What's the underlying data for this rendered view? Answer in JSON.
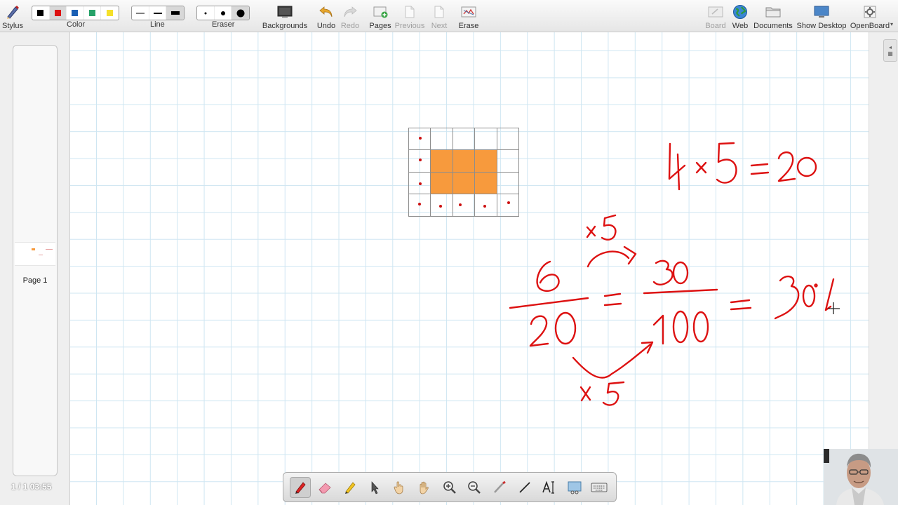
{
  "toolbar": {
    "stylus": "Stylus",
    "color": "Color",
    "line": "Line",
    "eraser": "Eraser",
    "backgrounds": "Backgrounds",
    "undo": "Undo",
    "redo": "Redo",
    "pages": "Pages",
    "previous": "Previous",
    "next": "Next",
    "erase": "Erase",
    "board": "Board",
    "web": "Web",
    "documents": "Documents",
    "show_desktop": "Show Desktop",
    "openboard": "OpenBoard"
  },
  "colors": [
    "#000000",
    "#dd1111",
    "#1a5fb4",
    "#26a269",
    "#f5e02a"
  ],
  "selected_color": "#dd1111",
  "left_panel": {
    "page_label": "Page 1",
    "page_info": "1 / 1  03:55"
  },
  "board": {
    "grid_cells_filled": [
      [
        1,
        1
      ],
      [
        1,
        2
      ],
      [
        1,
        3
      ],
      [
        2,
        1
      ],
      [
        2,
        2
      ],
      [
        2,
        3
      ]
    ],
    "grid_rows": 4,
    "grid_cols": 5,
    "handwriting": [
      "4 × 5 = 20",
      "×5",
      "6/20 = 30/100 = 30%",
      "×5"
    ]
  },
  "dock": {
    "tools": [
      "pen-tool-icon",
      "eraser-tool-icon",
      "highlighter-tool-icon",
      "select-tool-icon",
      "interact-tool-icon",
      "hand-tool-icon",
      "zoom-in-icon",
      "zoom-out-icon",
      "pointer-tool-icon",
      "line-tool-icon",
      "text-tool-icon",
      "capture-tool-icon",
      "keyboard-icon"
    ],
    "active": "pen-tool-icon"
  }
}
